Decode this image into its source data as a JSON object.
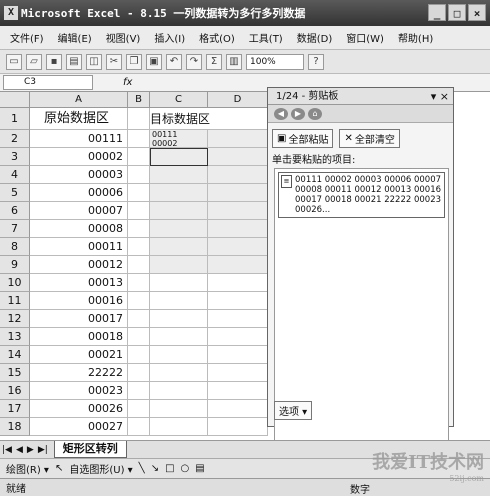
{
  "window": {
    "title": "Microsoft Excel - 8.15 一列数据转为多行多列数据",
    "app_icon": "excel-icon",
    "controls": [
      "_",
      "□",
      "×"
    ]
  },
  "menu": {
    "items": [
      "文件(F)",
      "编辑(E)",
      "视图(V)",
      "插入(I)",
      "格式(O)",
      "工具(T)",
      "数据(D)",
      "窗口(W)",
      "帮助(H)"
    ]
  },
  "toolbar": {
    "zoom": "100%",
    "sum": "Σ"
  },
  "formula_bar": {
    "name_box": "C3",
    "fx": "fx",
    "content": ""
  },
  "columns": [
    "A",
    "B",
    "C",
    "D"
  ],
  "rows": [
    "1",
    "2",
    "3",
    "4",
    "5",
    "6",
    "7",
    "8",
    "9",
    "10",
    "11",
    "12",
    "13",
    "14",
    "15",
    "16",
    "17",
    "18"
  ],
  "cells": {
    "A1": "原始数据区",
    "C1": "目标数据区",
    "C2": "00111 00002",
    "A": [
      "00111",
      "00002",
      "00003",
      "00006",
      "00007",
      "00008",
      "00011",
      "00012",
      "00013",
      "00016",
      "00017",
      "00018",
      "00021",
      "22222",
      "00023",
      "00026",
      "00027"
    ]
  },
  "clipboard": {
    "header": "1/24 - 剪贴板",
    "paste_all": "全部粘贴",
    "clear_all": "全部清空",
    "hint": "单击要粘贴的项目:",
    "item_text": "00111 00002 00003 00006 00007 00008 00011 00012 00013 00016 00017 00018 00021 22222 00023 00026...",
    "options": "选项 ▾"
  },
  "sheet_tabs": {
    "active": "矩形区转列"
  },
  "drawbar": {
    "draw_label": "绘图(R) ▾",
    "autoshape": "自选图形(U) ▾"
  },
  "status": {
    "ready": "就绪",
    "num": "数字"
  },
  "watermark": {
    "main": "我爱IT技术网",
    "sub": "52ij.com"
  }
}
